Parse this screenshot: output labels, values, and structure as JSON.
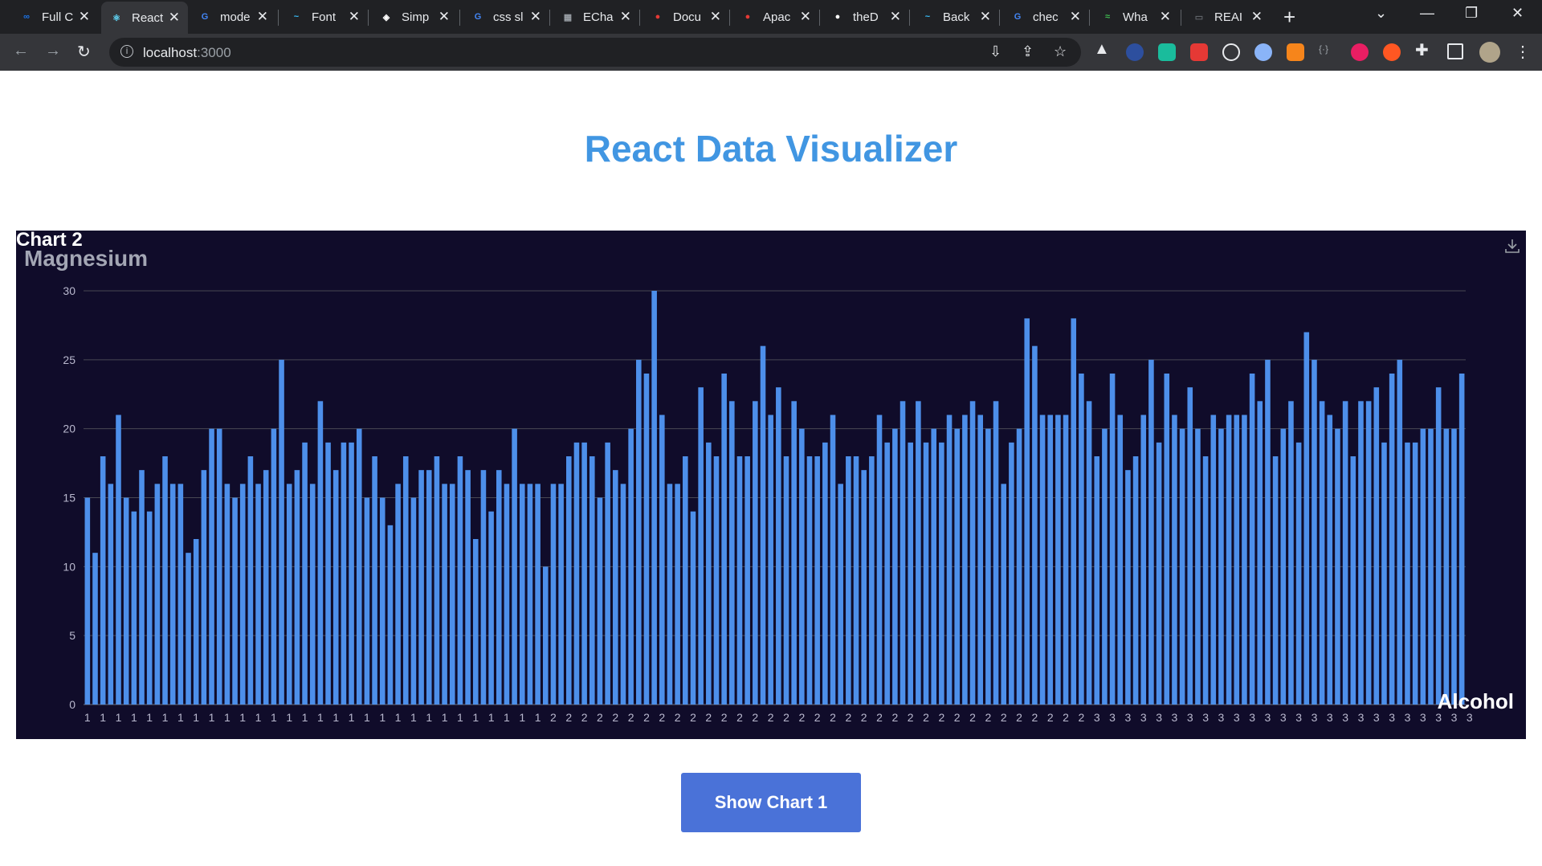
{
  "browser": {
    "tabs": [
      {
        "label": "Full C",
        "color": "#1a73e8",
        "glyph": "∞"
      },
      {
        "label": "React",
        "color": "#61dafb",
        "glyph": "⚛",
        "active": true
      },
      {
        "label": "mode",
        "color": "#4285f4",
        "glyph": "G"
      },
      {
        "label": "Font",
        "color": "#38bdf8",
        "glyph": "~"
      },
      {
        "label": "Simp",
        "color": "#ffffff",
        "glyph": "◈"
      },
      {
        "label": "css sl",
        "color": "#4285f4",
        "glyph": "G"
      },
      {
        "label": "ECha",
        "color": "#9aa0a6",
        "glyph": "▦"
      },
      {
        "label": "Docu",
        "color": "#e53935",
        "glyph": "●"
      },
      {
        "label": "Apac",
        "color": "#e53935",
        "glyph": "●"
      },
      {
        "label": "theD",
        "color": "#ffffff",
        "glyph": "●"
      },
      {
        "label": "Back",
        "color": "#38bdf8",
        "glyph": "~"
      },
      {
        "label": "chec",
        "color": "#4285f4",
        "glyph": "G"
      },
      {
        "label": "Wha",
        "color": "#3fb950",
        "glyph": "≈"
      },
      {
        "label": "REAI",
        "color": "#5f6368",
        "glyph": "▭"
      }
    ],
    "url_host": "localhost",
    "url_port": ":3000"
  },
  "page": {
    "title": "React Data Visualizer",
    "button_label": "Show Chart 1"
  },
  "chart_data": {
    "type": "bar",
    "title": "Chart 2",
    "subtitle": "Magnesium",
    "xlabel": "Alcohol",
    "ylabel": "Magnesium",
    "ylim": [
      0,
      30
    ],
    "yticks": [
      0,
      5,
      10,
      15,
      20,
      25,
      30
    ],
    "grid": true,
    "series_color": "#4d8fea",
    "background": "#100c2a",
    "categories": [
      "1",
      "1",
      "1",
      "1",
      "1",
      "1",
      "1",
      "1",
      "1",
      "1",
      "1",
      "1",
      "1",
      "1",
      "1",
      "1",
      "1",
      "1",
      "1",
      "1",
      "1",
      "1",
      "1",
      "1",
      "1",
      "1",
      "1",
      "1",
      "1",
      "1",
      "1",
      "1",
      "1",
      "1",
      "1",
      "1",
      "1",
      "1",
      "1",
      "1",
      "1",
      "1",
      "1",
      "1",
      "1",
      "1",
      "1",
      "1",
      "1",
      "1",
      "1",
      "1",
      "1",
      "1",
      "1",
      "1",
      "1",
      "1",
      "1",
      "2",
      "2",
      "2",
      "2",
      "2",
      "2",
      "2",
      "2",
      "2",
      "2",
      "2",
      "2",
      "2",
      "2",
      "2",
      "2",
      "2",
      "2",
      "2",
      "2",
      "2",
      "2",
      "2",
      "2",
      "2",
      "2",
      "2",
      "2",
      "2",
      "2",
      "2",
      "2",
      "2",
      "2",
      "2",
      "2",
      "2",
      "2",
      "2",
      "2",
      "2",
      "2",
      "2",
      "2",
      "2",
      "2",
      "2",
      "2",
      "2",
      "2",
      "2",
      "2",
      "2",
      "2",
      "2",
      "2",
      "2",
      "2",
      "2",
      "2",
      "2",
      "2",
      "2",
      "2",
      "2",
      "2",
      "2",
      "2",
      "2",
      "2",
      "2",
      "3",
      "3",
      "3",
      "3",
      "3",
      "3",
      "3",
      "3",
      "3",
      "3",
      "3",
      "3",
      "3",
      "3",
      "3",
      "3",
      "3",
      "3",
      "3",
      "3",
      "3",
      "3",
      "3",
      "3",
      "3",
      "3",
      "3",
      "3",
      "3",
      "3",
      "3",
      "3",
      "3",
      "3",
      "3",
      "3",
      "3",
      "3",
      "3",
      "3",
      "3",
      "3",
      "3",
      "3",
      "3",
      "3",
      "3",
      "3"
    ],
    "xtick_labels": [
      "1",
      "1",
      "1",
      "1",
      "1",
      "1",
      "1",
      "1",
      "1",
      "1",
      "1",
      "1",
      "1",
      "1",
      "1",
      "1",
      "1",
      "1",
      "1",
      "1",
      "1",
      "1",
      "1",
      "1",
      "1",
      "1",
      "1",
      "1",
      "1",
      "1",
      "2",
      "2",
      "2",
      "2",
      "2",
      "2",
      "2",
      "2",
      "2",
      "2",
      "2",
      "2",
      "2",
      "2",
      "2",
      "2",
      "2",
      "2",
      "2",
      "2",
      "2",
      "2",
      "2",
      "2",
      "2",
      "2",
      "2",
      "2",
      "2",
      "2",
      "2",
      "2",
      "2",
      "2",
      "2",
      "3",
      "3",
      "3",
      "3",
      "3",
      "3",
      "3",
      "3",
      "3",
      "3",
      "3",
      "3",
      "3",
      "3",
      "3",
      "3",
      "3",
      "3",
      "3",
      "3",
      "3",
      "3",
      "3",
      "3",
      "3"
    ],
    "values": [
      15,
      11,
      18,
      16,
      21,
      15,
      14,
      17,
      14,
      16,
      18,
      16,
      16,
      11,
      12,
      17,
      20,
      20,
      16,
      15,
      16,
      18,
      16,
      17,
      20,
      25,
      16,
      17,
      19,
      16,
      22,
      19,
      17,
      19,
      19,
      20,
      15,
      18,
      15,
      13,
      16,
      18,
      15,
      17,
      17,
      18,
      16,
      16,
      18,
      17,
      12,
      17,
      14,
      17,
      16,
      20,
      16,
      16,
      16,
      10,
      16,
      16,
      18,
      19,
      19,
      18,
      15,
      19,
      17,
      16,
      20,
      25,
      24,
      30,
      21,
      16,
      16,
      18,
      14,
      23,
      19,
      18,
      24,
      22,
      18,
      18,
      22,
      26,
      21,
      23,
      18,
      22,
      20,
      18,
      18,
      19,
      21,
      16,
      18,
      18,
      17,
      18,
      21,
      19,
      20,
      22,
      19,
      22,
      19,
      20,
      19,
      21,
      20,
      21,
      22,
      21,
      20,
      22,
      16,
      19,
      20,
      28,
      26,
      21,
      21,
      21,
      21,
      28,
      24,
      22,
      18,
      20,
      24,
      21,
      17,
      18,
      21,
      25,
      19,
      24,
      21,
      20,
      23,
      20,
      18,
      21,
      20,
      21,
      21,
      21,
      24,
      22,
      25,
      18,
      20,
      22,
      19,
      27,
      25,
      22,
      21,
      20,
      22,
      18,
      22,
      22,
      23,
      19,
      24,
      25,
      19,
      19,
      20,
      20,
      23,
      20,
      20,
      24
    ]
  }
}
